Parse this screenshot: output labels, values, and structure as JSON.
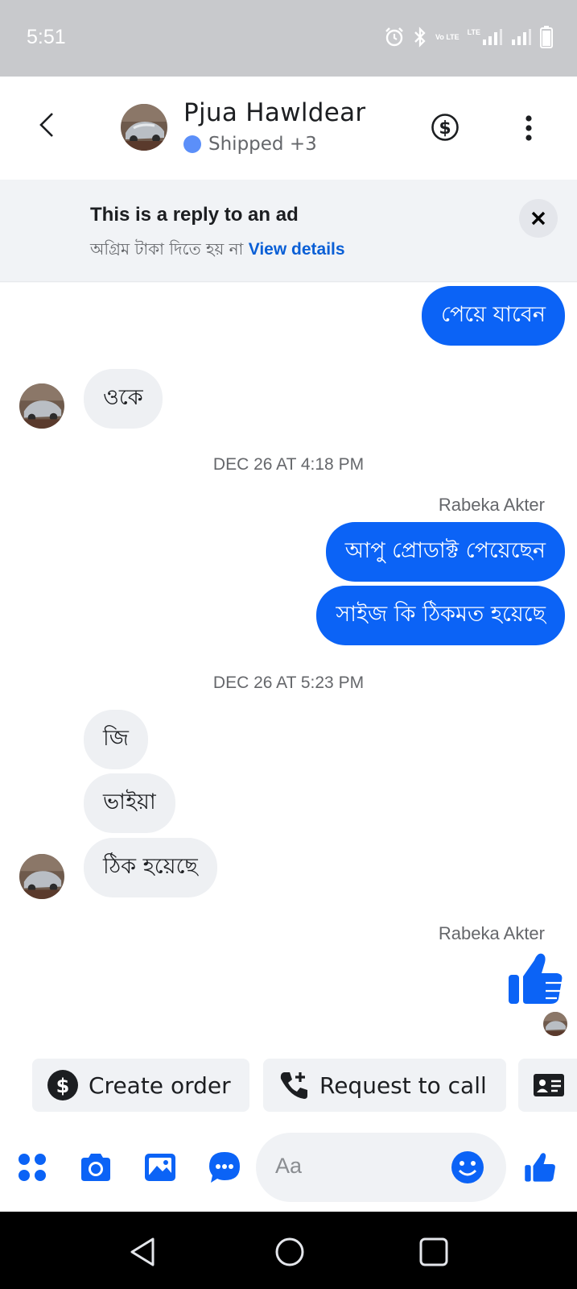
{
  "status_bar": {
    "time": "5:51",
    "volte_label": "Vo LTE",
    "lte_label": "LTE",
    "icons": [
      "alarm-icon",
      "bluetooth-icon",
      "volte-icon",
      "signal-icon",
      "signal-icon",
      "battery-icon"
    ]
  },
  "header": {
    "name": "Pjua Hawldear",
    "status": "Shipped +3",
    "status_color": "#5b8ff9",
    "icons": [
      "back-arrow-icon",
      "dollar-icon",
      "more-icon"
    ]
  },
  "ad_banner": {
    "title": "This is a reply to an ad",
    "subtitle": "অগ্রিম টাকা দিতে হয় না",
    "link": "View details"
  },
  "messages": {
    "m1": "পেয়ে যাবেন",
    "m2": "ওকে",
    "ts1": "DEC 26 AT 4:18 PM",
    "sender1": "Rabeka Akter",
    "m3": "আপু প্রোডাক্ট পেয়েছেন",
    "m4": "সাইজ কি ঠিকমত হয়েছে",
    "ts2": "DEC 26 AT 5:23 PM",
    "m5": "জি",
    "m6": "ভাইয়া",
    "m7": "ঠিক হয়েছে",
    "sender2": "Rabeka Akter",
    "thumbs_icon": "thumbs-up-icon"
  },
  "quick_actions": {
    "create_order": "Create order",
    "request_call": "Request to call",
    "icons": [
      "dollar-icon",
      "phone-plus-icon",
      "contact-card-icon"
    ]
  },
  "composer": {
    "placeholder": "Aa",
    "icons": [
      "apps-icon",
      "camera-icon",
      "gallery-icon",
      "chat-bubble-icon",
      "emoji-icon",
      "thumbs-up-icon"
    ]
  },
  "nav": {
    "icons": [
      "back-triangle-icon",
      "home-circle-icon",
      "recents-square-icon"
    ]
  },
  "colors": {
    "accent": "#0b63f6",
    "incoming_bubble": "#eef0f3",
    "link": "#0a5fd6"
  }
}
